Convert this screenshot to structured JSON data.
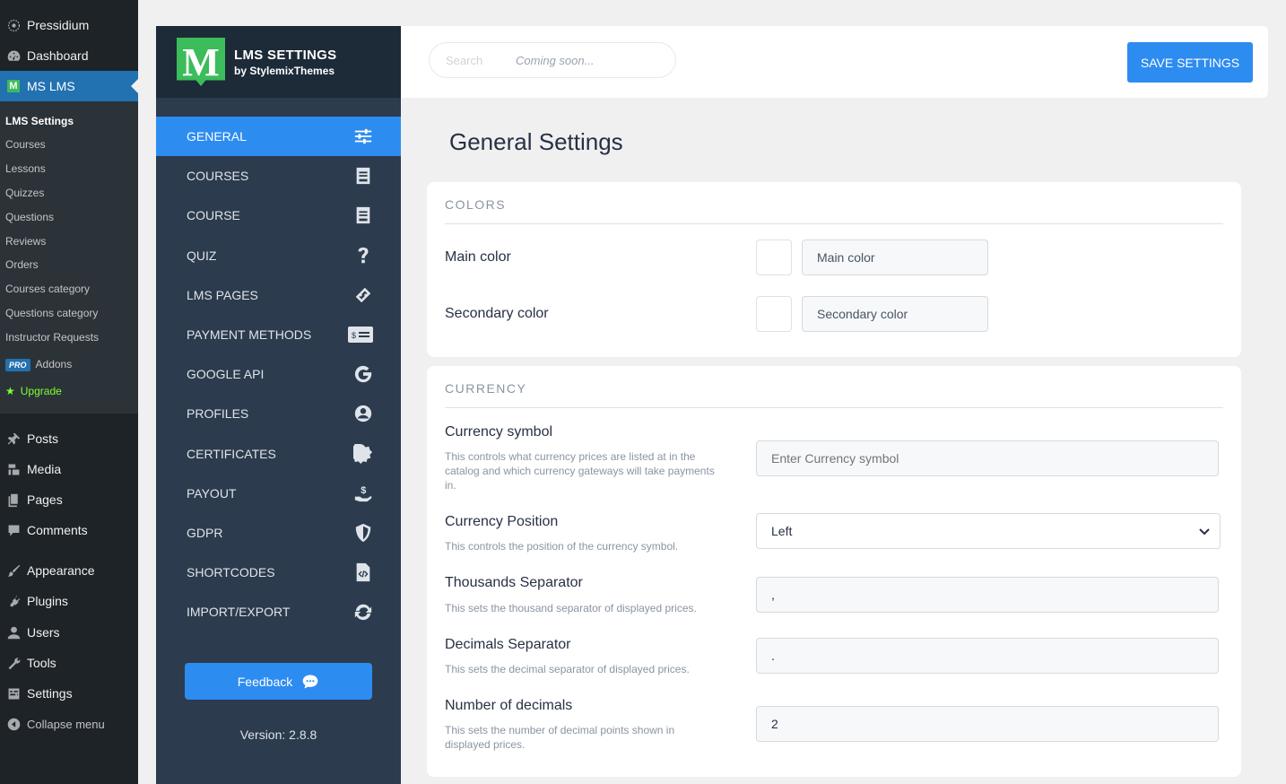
{
  "wp_menu": {
    "site": "Pressidium",
    "dashboard": "Dashboard",
    "ms_lms": "MS LMS",
    "submenu": [
      "LMS Settings",
      "Courses",
      "Lessons",
      "Quizzes",
      "Questions",
      "Reviews",
      "Orders",
      "Courses category",
      "Questions category",
      "Instructor Requests"
    ],
    "addons_badge": "PRO",
    "addons": "Addons",
    "upgrade": "Upgrade",
    "items": [
      "Posts",
      "Media",
      "Pages",
      "Comments",
      "Appearance",
      "Plugins",
      "Users",
      "Tools",
      "Settings",
      "Collapse menu"
    ]
  },
  "lms_brand": {
    "logo_letter": "M",
    "title": "LMS SETTINGS",
    "subtitle": "by StylemixThemes"
  },
  "lms_nav": [
    {
      "label": "GENERAL",
      "icon": "sliders-icon"
    },
    {
      "label": "COURSES",
      "icon": "book-icon"
    },
    {
      "label": "COURSE",
      "icon": "book-icon"
    },
    {
      "label": "QUIZ",
      "icon": "question-icon"
    },
    {
      "label": "LMS PAGES",
      "icon": "link-icon"
    },
    {
      "label": "PAYMENT METHODS",
      "icon": "money-check-icon"
    },
    {
      "label": "GOOGLE API",
      "icon": "google-icon"
    },
    {
      "label": "PROFILES",
      "icon": "user-circle-icon"
    },
    {
      "label": "CERTIFICATES",
      "icon": "certificate-icon"
    },
    {
      "label": "PAYOUT",
      "icon": "hand-dollar-icon"
    },
    {
      "label": "GDPR",
      "icon": "shield-icon"
    },
    {
      "label": "SHORTCODES",
      "icon": "code-file-icon"
    },
    {
      "label": "IMPORT/EXPORT",
      "icon": "sync-icon"
    }
  ],
  "feedback": "Feedback",
  "version": "Version: 2.8.8",
  "topbar": {
    "search_placeholder": "Search",
    "coming_soon": "Coming soon...",
    "save": "SAVE SETTINGS"
  },
  "page_title": "General Settings",
  "colors": {
    "heading": "COLORS",
    "main_label": "Main color",
    "main_value": "Main color",
    "secondary_label": "Secondary color",
    "secondary_value": "Secondary color"
  },
  "currency": {
    "heading": "CURRENCY",
    "symbol_label": "Currency symbol",
    "symbol_desc": "This controls what currency prices are listed at in the catalog and which currency gateways will take payments in.",
    "symbol_placeholder": "Enter Currency symbol",
    "position_label": "Currency Position",
    "position_desc": "This controls the position of the currency symbol.",
    "position_value": "Left",
    "thousands_label": "Thousands Separator",
    "thousands_desc": "This sets the thousand separator of displayed prices.",
    "thousands_value": ",",
    "decimals_label": "Decimals Separator",
    "decimals_desc": "This sets the decimal separator of displayed prices.",
    "decimals_value": ".",
    "num_decimals_label": "Number of decimals",
    "num_decimals_desc": "This sets the number of decimal points shown in displayed prices.",
    "num_decimals_value": "2"
  },
  "accent_color": "#2d8cf0"
}
